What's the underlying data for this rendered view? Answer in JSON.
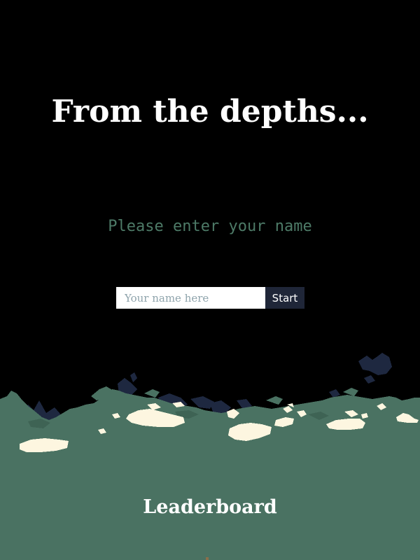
{
  "game": {
    "title": "From the depths...",
    "prompt": "Please enter your name",
    "name_input": {
      "value": "",
      "placeholder": "Your name here"
    },
    "start_label": "Start",
    "leaderboard_label": "Leaderboard"
  },
  "colors": {
    "background": "#000000",
    "ground": "#4a7262",
    "rock_dark": "#1e2840",
    "snow": "#fdf6e0",
    "prompt_text": "#4d7a67",
    "start_button": "#1f2638"
  }
}
